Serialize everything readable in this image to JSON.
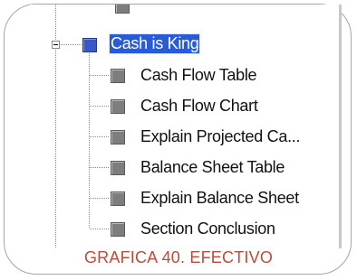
{
  "tree": {
    "parent": {
      "label": "Cash is King"
    },
    "children": [
      {
        "label": "Cash Flow Table"
      },
      {
        "label": "Cash Flow Chart"
      },
      {
        "label": "Explain Projected Ca..."
      },
      {
        "label": "Balance Sheet Table"
      },
      {
        "label": "Explain Balance Sheet"
      },
      {
        "label": "Section Conclusion"
      }
    ]
  },
  "caption": {
    "text": "GRAFICA 40. EFECTIVO"
  },
  "colors": {
    "selection": "#2a5bd7",
    "parent_icon": "#3b57c4",
    "child_icon": "#7d7d7d",
    "caption": "#c04a3a"
  }
}
